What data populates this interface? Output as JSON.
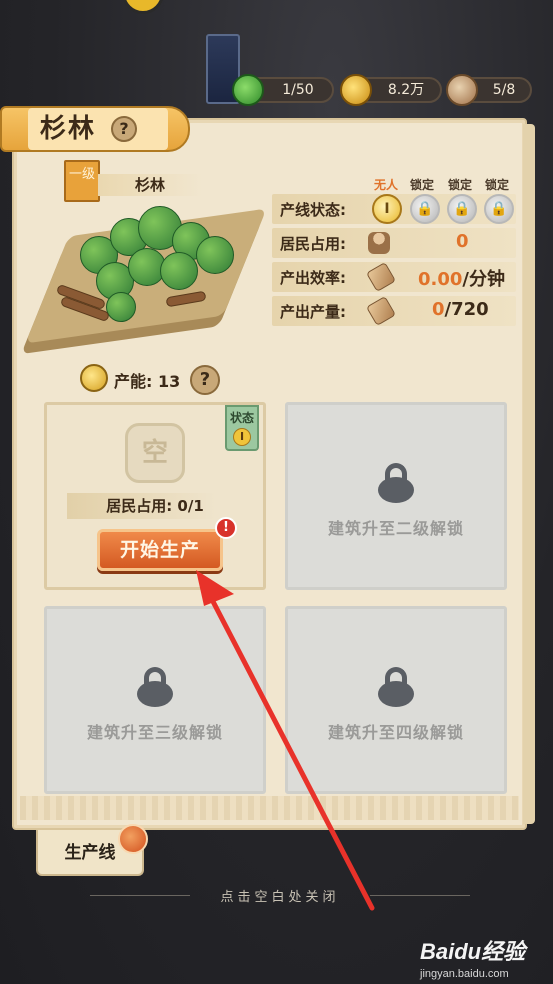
{
  "resources": {
    "residents": "1/50",
    "coins": "8.2万",
    "wood": "5/8"
  },
  "building": {
    "title": "杉林",
    "help": "?",
    "level_label": "一级",
    "name": "杉林",
    "capacity_label": "产能: 13",
    "capacity_help": "?"
  },
  "info": {
    "state_heads": [
      "无人",
      "锁定",
      "锁定",
      "锁定"
    ],
    "line_status_label": "产线状态:",
    "slot_active": "I",
    "residents_label": "居民占用:",
    "residents_value": "0",
    "efficiency_label": "产出效率:",
    "efficiency_value": "0.00",
    "efficiency_unit": "/分钟",
    "output_label": "产出产量:",
    "output_current": "0",
    "output_max": "/720"
  },
  "lines": {
    "line1": {
      "empty_glyph": "空",
      "state_tag": "状态",
      "state_num": "I",
      "occupancy": "居民占用: 0/1",
      "start_button": "开始生产",
      "alert": "!"
    },
    "line2_lock": "建筑升至二级解锁",
    "line3_lock": "建筑升至三级解锁",
    "line4_lock": "建筑升至四级解锁"
  },
  "bottom_tab": "生产线",
  "close_hint": "点击空白处关闭",
  "watermark": {
    "brand": "Baidu经验",
    "url": "jingyan.baidu.com"
  },
  "colors": {
    "accent_orange": "#e0722a",
    "start_button": "#d45a22",
    "arrow_red": "#e8322a"
  }
}
